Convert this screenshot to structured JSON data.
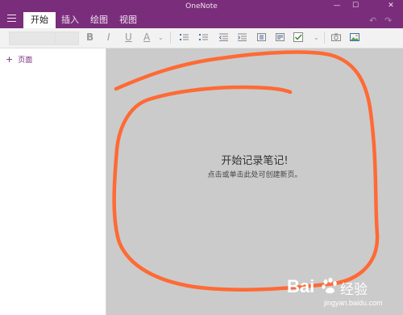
{
  "app": {
    "title": "OneNote"
  },
  "tabs": [
    {
      "label": "开始",
      "active": true
    },
    {
      "label": "插入",
      "active": false
    },
    {
      "label": "绘图",
      "active": false
    },
    {
      "label": "视图",
      "active": false
    }
  ],
  "toolbar": {
    "bold": "B",
    "italic": "I",
    "underline": "U",
    "font_color": "A",
    "icons": [
      "bulleted-list-icon",
      "numbered-list-icon",
      "decrease-indent-icon",
      "increase-indent-icon",
      "to-do-list-icon",
      "checkbox-icon",
      "camera-icon",
      "image-icon"
    ]
  },
  "sidebar": {
    "add_page_label": "页面"
  },
  "canvas": {
    "title": "开始记录笔记!",
    "subtitle": "点击或单击此处可创建新页。"
  },
  "watermark": {
    "brand": "Bai",
    "brand2": "经验",
    "url": "jingyan.baidu.com"
  },
  "colors": {
    "accent": "#7a2d7a",
    "annotation": "#ff6a35",
    "canvas_bg": "#cbcbcb"
  }
}
